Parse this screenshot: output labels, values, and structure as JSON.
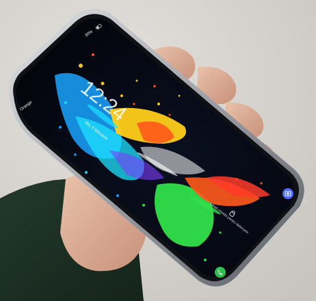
{
  "photo": {
    "description_free": true
  },
  "phone_screen": {
    "carrier": "Orange",
    "battery_percent": "30%",
    "clock_time": "12:24",
    "date_text": "Ma, 6 februarie",
    "unlock_hint": "Glisați oriunde pentru deblocare"
  },
  "colors": {
    "wall": "#d9d6d1",
    "sleeve": "#1f3326",
    "phone_body": "#111214",
    "phone_frame": "#b9bcc1",
    "screen_bg": "#04070d",
    "splash_blue": "#1aa3ff",
    "splash_yellow": "#ffcf1a",
    "splash_orange": "#ff5a1a",
    "splash_green": "#2fe04a",
    "splash_cyan": "#1de1ff",
    "splash_purple": "#7d3cff",
    "icon_blue": "#4c6bff",
    "icon_green": "#2fbf4f"
  },
  "icons": [
    "camera-shortcut-icon",
    "phone-shortcut-icon",
    "lock-icon",
    "battery-icon"
  ]
}
